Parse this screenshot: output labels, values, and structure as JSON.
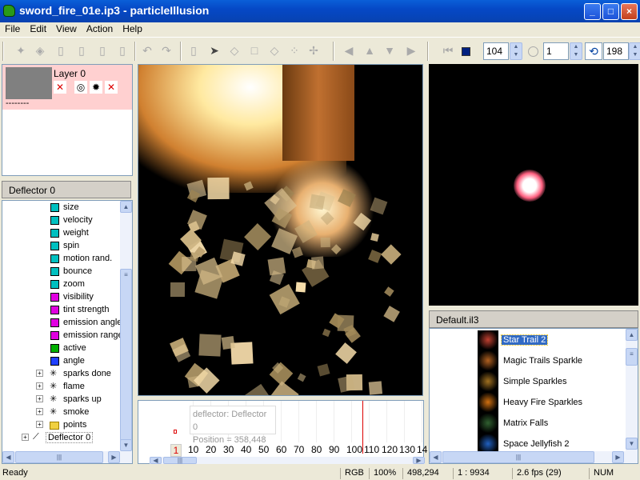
{
  "window": {
    "title": "sword_fire_01e.ip3 - particleIllusion",
    "min": "_",
    "max": "□",
    "close": "×"
  },
  "menu": [
    "File",
    "Edit",
    "View",
    "Action",
    "Help"
  ],
  "toolbar": {
    "start_frame": "104",
    "frame_step": "1",
    "end_frame": "198"
  },
  "layer": {
    "name": "Layer 0",
    "dashes": "--------"
  },
  "tree_header": "Deflector 0",
  "tree": [
    {
      "label": "size",
      "color": "#00c0c0"
    },
    {
      "label": "velocity",
      "color": "#00c0c0"
    },
    {
      "label": "weight",
      "color": "#00c0c0"
    },
    {
      "label": "spin",
      "color": "#00c0c0"
    },
    {
      "label": "motion rand.",
      "color": "#00c0c0"
    },
    {
      "label": "bounce",
      "color": "#00c0c0"
    },
    {
      "label": "zoom",
      "color": "#00c0c0"
    },
    {
      "label": "visibility",
      "color": "#e000e0"
    },
    {
      "label": "tint strength",
      "color": "#e000e0"
    },
    {
      "label": "emission angle",
      "color": "#e000e0"
    },
    {
      "label": "emission range",
      "color": "#e000e0"
    },
    {
      "label": "active",
      "color": "#00b000"
    },
    {
      "label": "angle",
      "color": "#2040ff"
    }
  ],
  "tree_groups": [
    "sparks done",
    "flame",
    "sparks up",
    "smoke",
    "points"
  ],
  "tree_root": "Deflector 0",
  "timeline": {
    "tooltip_line1": "deflector:  Deflector 0",
    "tooltip_line2": "Position = 358,448",
    "current": "1",
    "ticks": [
      "10",
      "20",
      "30",
      "40",
      "50",
      "60",
      "70",
      "80",
      "90",
      "100",
      "110",
      "120",
      "130",
      "14"
    ]
  },
  "library": {
    "header": "Default.il3",
    "items": [
      "Star Trail 2",
      "Magic Trails Sparkle",
      "Simple Sparkles",
      "Heavy Fire Sparkles",
      "Matrix Falls",
      "Space Jellyfish 2"
    ],
    "selected": "Star Trail 2"
  },
  "status": {
    "text": "Ready",
    "mode": "RGB",
    "zoom": "100%",
    "coords": "498,294",
    "ratio": "1 : 9934",
    "fps": "2.6 fps (29)",
    "num": "NUM"
  }
}
